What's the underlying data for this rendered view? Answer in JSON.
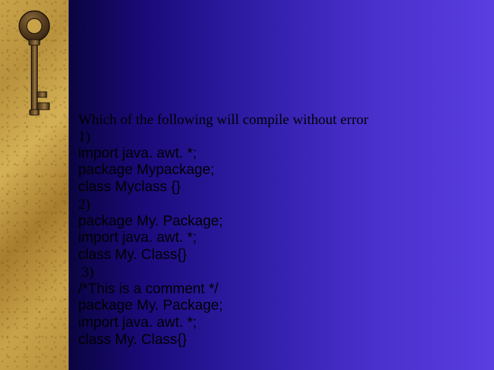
{
  "slide": {
    "question": "Which of the following will compile without error",
    "option1_label": "1)",
    "option1_line1": "import java. awt. *;",
    "option1_line2": "package Mypackage;",
    "option1_line3": "class Myclass {}",
    "option2_label": "2)",
    "option2_line1": "package My. Package;",
    "option2_line2": "import java. awt. *;",
    "option2_line3": "class My. Class{}",
    "option3_label": " 3)",
    "option3_line1": "/*This is a comment */",
    "option3_line2": "package My. Package;",
    "option3_line3": "import java. awt. *;",
    "option3_line4": "class My. Class{}"
  },
  "icons": {
    "key": "key-icon"
  },
  "colors": {
    "gold": "#b8923d",
    "purple_dark": "#1a0a7a",
    "purple_light": "#5a3ee0"
  }
}
